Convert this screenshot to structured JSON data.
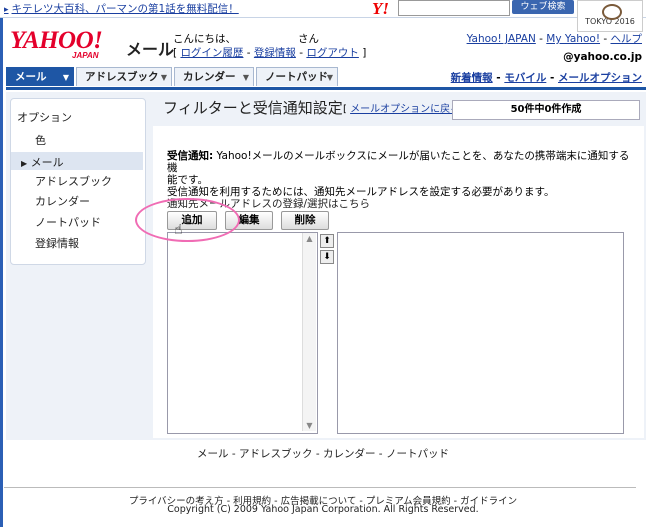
{
  "topbar": {
    "ticker_text": "キテレツ大百科、パーマンの第1話を無料配信！",
    "search_button": "ウェブ検索",
    "olympic_label": "TOKYO 2016"
  },
  "header": {
    "logo": "YAHOO!",
    "logo_sub": "JAPAN",
    "service_title": "メール",
    "greeting": "こんにちは、",
    "greeting_san": "さん",
    "login_history": "ログイン履歴",
    "registration": "登録情報",
    "logout": "ログアウト",
    "yahoo_japan": "Yahoo! JAPAN",
    "my_yahoo": "My Yahoo!",
    "help": "ヘルプ",
    "address": "@yahoo.co.jp"
  },
  "tabs": [
    {
      "label": "メール",
      "active": true
    },
    {
      "label": "アドレスブック",
      "active": false
    },
    {
      "label": "カレンダー",
      "active": false
    },
    {
      "label": "ノートパッド",
      "active": false
    }
  ],
  "tab_links": {
    "new_info": "新着情報",
    "mobile": "モバイル",
    "mail_option": "メールオプション"
  },
  "sidebar": {
    "heading": "オプション",
    "items": [
      "色",
      "メール",
      "アドレスブック",
      "カレンダー",
      "ノートパッド",
      "登録情報"
    ],
    "selected": "メール"
  },
  "main": {
    "title": "フィルターと受信通知設定",
    "back_link": "メールオプションに戻る",
    "count": "50件中0件作成",
    "desc_label": "受信通知:",
    "desc_line1": "Yahoo!メールのメールボックスにメールが届いたことを、あなたの携帯端末に通知する機",
    "desc_line2": "能です。",
    "desc_line3": "受信通知を利用するためには、通知先メールアドレスを設定する必要があります。",
    "desc_line4": "通知先メールアドレスの登録/選択はこちら",
    "buttons": {
      "add": "追加",
      "edit": "編集",
      "delete": "削除"
    }
  },
  "footer": {
    "nav": "メール - アドレスブック - カレンダー - ノートパッド",
    "links": "プライバシーの考え方 - 利用規約 - 広告掲載について - プレミアム会員規約 - ガイドライン",
    "copyright": "Copyright (C) 2009 Yahoo Japan Corporation. All Rights Reserved."
  },
  "colors": {
    "brand_red": "#e4002b",
    "tab_blue": "#1e56a5",
    "highlight_pink": "#f06cb4"
  }
}
